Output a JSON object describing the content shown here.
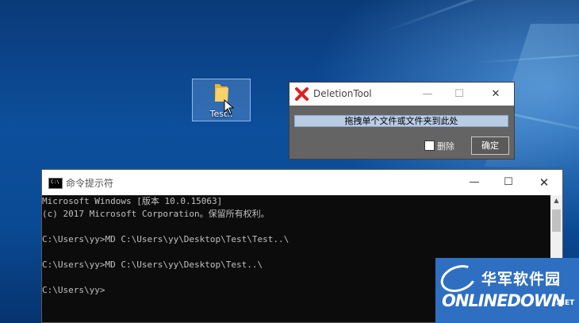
{
  "desktop": {
    "folder_label": "Test.."
  },
  "deletion_tool": {
    "title": "DeletionTool",
    "minimize_glyph": "—",
    "maximize_glyph": "☐",
    "close_glyph": "✕",
    "drop_hint": "拖拽单个文件或文件夹到此处",
    "delete_checkbox_label": "删除",
    "delete_checked": false,
    "confirm_button": "确定"
  },
  "cmd": {
    "title": "命令提示符",
    "icon_text": "C:\\",
    "minimize_glyph": "—",
    "maximize_glyph": "☐",
    "close_glyph": "✕",
    "lines": [
      "Microsoft Windows [版本 10.0.15063]",
      "(c) 2017 Microsoft Corporation。保留所有权利。",
      "",
      "C:\\Users\\yy>MD C:\\Users\\yy\\Desktop\\Test\\Test..\\",
      "",
      "C:\\Users\\yy>MD C:\\Users\\yy\\Desktop\\Test..\\",
      "",
      "C:\\Users\\yy>"
    ]
  },
  "watermark": {
    "chinese": "华军软件园",
    "english": "ONLINEDOWN",
    "suffix": ".NET"
  },
  "colors": {
    "desktop": "#0b3d7a",
    "console_bg": "#0c0c0c",
    "console_text": "#c0c0c0",
    "drop_zone": "#b8cce4",
    "watermark": "#2f6fc1"
  }
}
